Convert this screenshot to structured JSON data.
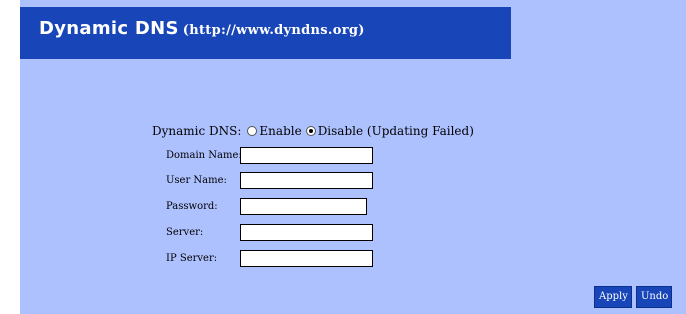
{
  "banner": {
    "title": "Dynamic DNS",
    "url": "(http://www.dyndns.org)"
  },
  "ddns": {
    "label": "Dynamic DNS:",
    "options": [
      {
        "label": "Enable",
        "selected": false
      },
      {
        "label": "Disable (Updating Failed)",
        "selected": true
      }
    ]
  },
  "fields": {
    "domain_name": {
      "label": "Domain Name:",
      "value": ""
    },
    "user_name": {
      "label": "User Name:",
      "value": ""
    },
    "password": {
      "label": "Password:",
      "value": ""
    },
    "server": {
      "label": "Server:",
      "value": ""
    },
    "ip_server": {
      "label": "IP Server:",
      "value": ""
    }
  },
  "buttons": {
    "apply": "Apply",
    "undo": "Undo"
  },
  "colors": {
    "background": "#aec1ff",
    "banner": "#1846b8",
    "button": "#1846b8"
  }
}
